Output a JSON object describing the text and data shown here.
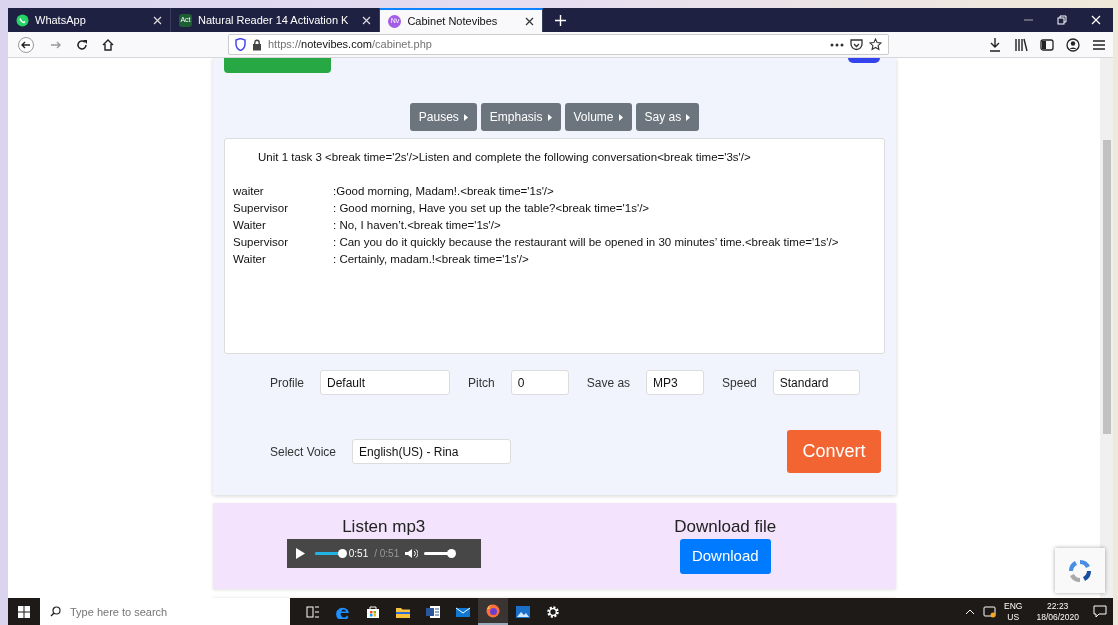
{
  "browser": {
    "tabs": [
      {
        "label": "WhatsApp",
        "selected": false
      },
      {
        "label": "Natural Reader 14 Activation K",
        "favicon_text": "Act",
        "color": "#1d5e34",
        "selected": false
      },
      {
        "label": "Cabinet Notevibes",
        "favicon_text": "Nv",
        "color": "#a35ee6",
        "selected": true
      }
    ],
    "address": {
      "scheme": "https://",
      "host": "notevibes.com",
      "path": "/cabinet.php"
    }
  },
  "editor": {
    "markup_buttons": [
      "Pauses",
      "Emphasis",
      "Volume",
      "Say as"
    ],
    "heading": "Unit 1 task 3 <break time='2s'/>Listen and complete the following conversation<break time='3s'/>",
    "dialogue": [
      {
        "speaker": "waiter",
        "line": ":Good morning, Madam!.<break time='1s'/>"
      },
      {
        "speaker": "Supervisor",
        "line": ": Good morning, Have you set up the table?<break time='1s'/>"
      },
      {
        "speaker": "Waiter",
        "line": ": No, I haven’t.<break time='1s'/>"
      },
      {
        "speaker": "Supervisor",
        "line": ": Can you do it quickly because the restaurant will be opened in 30 minutes’ time.<break time='1s'/>"
      },
      {
        "speaker": "Waiter",
        "line": ": Certainly, madam.!<break time='1s'/>"
      }
    ]
  },
  "settings": {
    "fields": [
      {
        "label": "Profile",
        "value": "Default"
      },
      {
        "label": "Pitch",
        "value": "0"
      },
      {
        "label": "Save as",
        "value": "MP3"
      },
      {
        "label": "Speed",
        "value": "Standard"
      }
    ],
    "voice": {
      "label": "Select Voice",
      "value": "English(US) - Rina"
    },
    "convert_button": "Convert"
  },
  "result": {
    "listen_title": "Listen mp3",
    "player": {
      "current_time": "0:51",
      "total_time": "/ 0:51",
      "progress": {
        "level": 1
      },
      "volume": {
        "level": 1
      }
    },
    "download_title": "Download file",
    "download_button": "Download"
  },
  "taskbar": {
    "search_placeholder": "Type here to search",
    "apps": [
      {
        "kind": "taskview",
        "selected": false
      },
      {
        "kind": "edge",
        "selected": false
      },
      {
        "kind": "store",
        "selected": false
      },
      {
        "kind": "explorer",
        "selected": false
      },
      {
        "kind": "word",
        "selected": false
      },
      {
        "kind": "mail",
        "selected": false
      },
      {
        "kind": "firefox",
        "selected": true
      },
      {
        "kind": "photos",
        "selected": false
      },
      {
        "kind": "settings",
        "selected": false
      }
    ],
    "tray": {
      "language": "ENG",
      "region": "US",
      "time": "22:23",
      "date": "18/06/2020"
    }
  }
}
